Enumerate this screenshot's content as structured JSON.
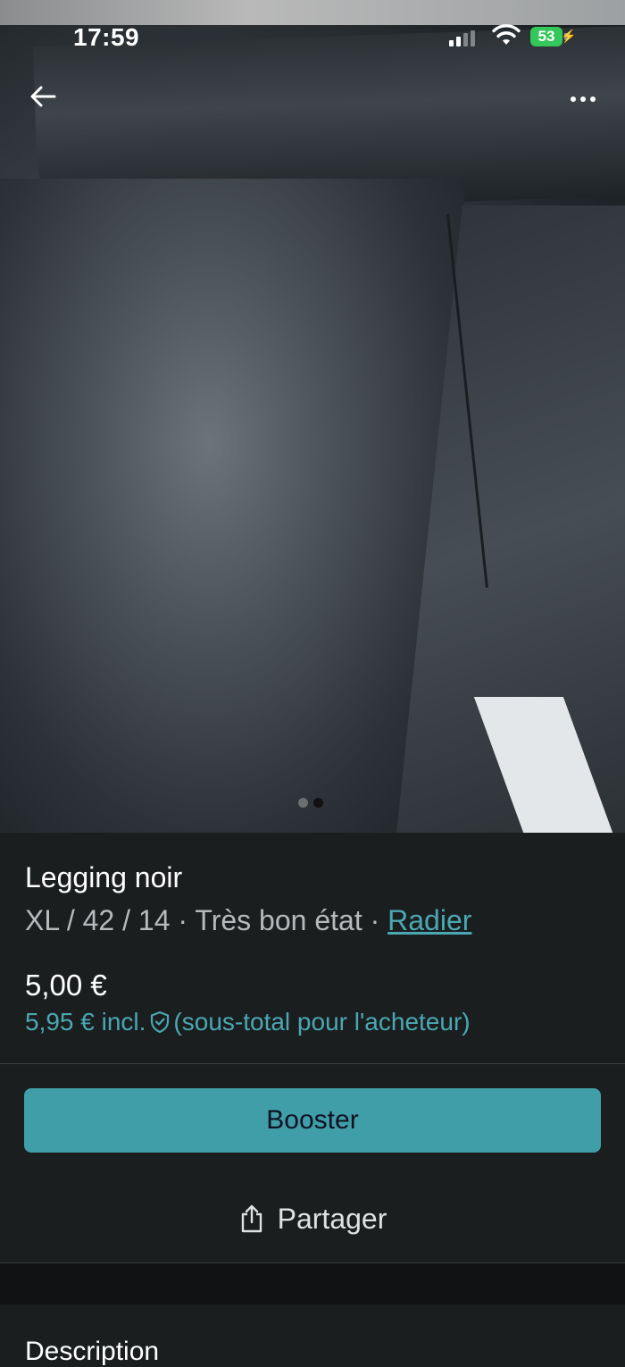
{
  "status_bar": {
    "time": "17:59",
    "battery": "53"
  },
  "product": {
    "title": "Legging noir",
    "size": "XL / 42 / 14",
    "separator": "·",
    "condition": "Très bon état",
    "brand_link": "Radier",
    "price": "5,00 €",
    "price_incl": "5,95 € incl.",
    "price_incl_note": "(sous-total pour l'acheteur)"
  },
  "carousel": {
    "total": 2,
    "active_index": 2
  },
  "actions": {
    "booster_label": "Booster",
    "share_label": "Partager"
  },
  "section": {
    "description_heading": "Description"
  },
  "colors": {
    "accent": "#3f9ea8",
    "link": "#4aa8b3",
    "background": "#1b1e1f",
    "battery": "#34c759"
  }
}
